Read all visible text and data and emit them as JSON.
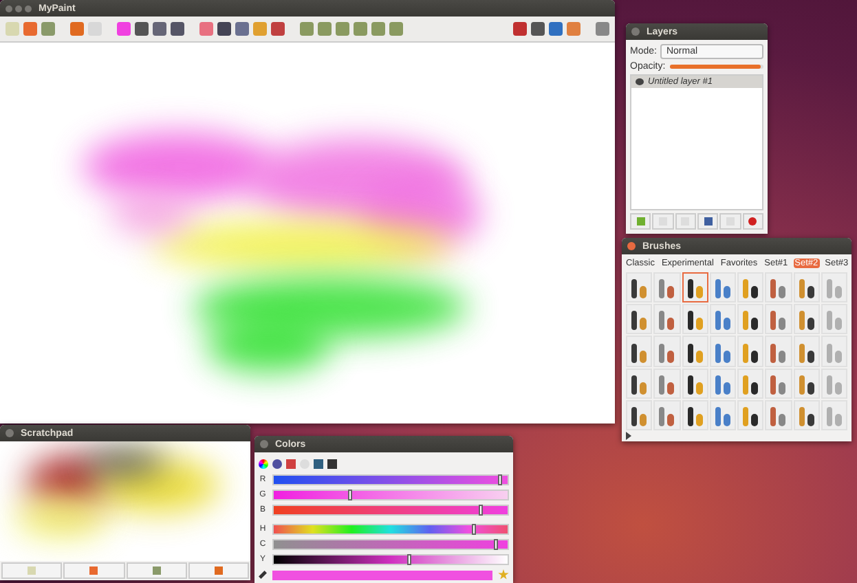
{
  "main_window": {
    "title": "MyPaint"
  },
  "layers": {
    "title": "Layers",
    "mode_label": "Mode:",
    "mode_value": "Normal",
    "opacity_label": "Opacity:",
    "opacity": {
      "level": 0.97
    },
    "items": [
      {
        "name": "Untitled layer #1",
        "visible": true,
        "selected": true
      }
    ]
  },
  "brushes": {
    "title": "Brushes",
    "tabs": [
      {
        "label": "Classic",
        "selected": false
      },
      {
        "label": "Experimental",
        "selected": false
      },
      {
        "label": "Favorites",
        "selected": false
      },
      {
        "label": "Set#1",
        "selected": false
      },
      {
        "label": "Set#2",
        "selected": true
      },
      {
        "label": "Set#3",
        "selected": false
      }
    ],
    "items": [
      {
        "selected": false
      },
      {
        "selected": false
      },
      {
        "selected": true
      },
      {
        "selected": false
      },
      {
        "selected": false
      },
      {
        "selected": false
      },
      {
        "selected": false
      },
      {
        "selected": false
      },
      {
        "selected": false
      },
      {
        "selected": false
      },
      {
        "selected": false
      },
      {
        "selected": false
      },
      {
        "selected": false
      },
      {
        "selected": false
      },
      {
        "selected": false
      },
      {
        "selected": false
      },
      {
        "selected": false
      },
      {
        "selected": false
      },
      {
        "selected": false
      },
      {
        "selected": false
      },
      {
        "selected": false
      },
      {
        "selected": false
      },
      {
        "selected": false
      },
      {
        "selected": false
      },
      {
        "selected": false
      },
      {
        "selected": false
      },
      {
        "selected": false
      },
      {
        "selected": false
      },
      {
        "selected": false
      },
      {
        "selected": false
      },
      {
        "selected": false
      },
      {
        "selected": false
      },
      {
        "selected": false
      },
      {
        "selected": false
      },
      {
        "selected": false
      },
      {
        "selected": false
      },
      {
        "selected": false
      },
      {
        "selected": false
      },
      {
        "selected": false
      },
      {
        "selected": false
      }
    ]
  },
  "scratchpad": {
    "title": "Scratchpad"
  },
  "colors": {
    "title": "Colors",
    "sliders": [
      {
        "label": "R",
        "level": 0.97,
        "kind": "r"
      },
      {
        "label": "G",
        "level": 0.33,
        "kind": "g"
      },
      {
        "label": "B",
        "level": 0.89,
        "kind": "b"
      },
      {
        "label": "H",
        "level": 0.86,
        "kind": "h"
      },
      {
        "label": "C",
        "level": 0.95,
        "kind": "c"
      },
      {
        "label": "Y",
        "level": 0.58,
        "kind": "y"
      }
    ]
  }
}
